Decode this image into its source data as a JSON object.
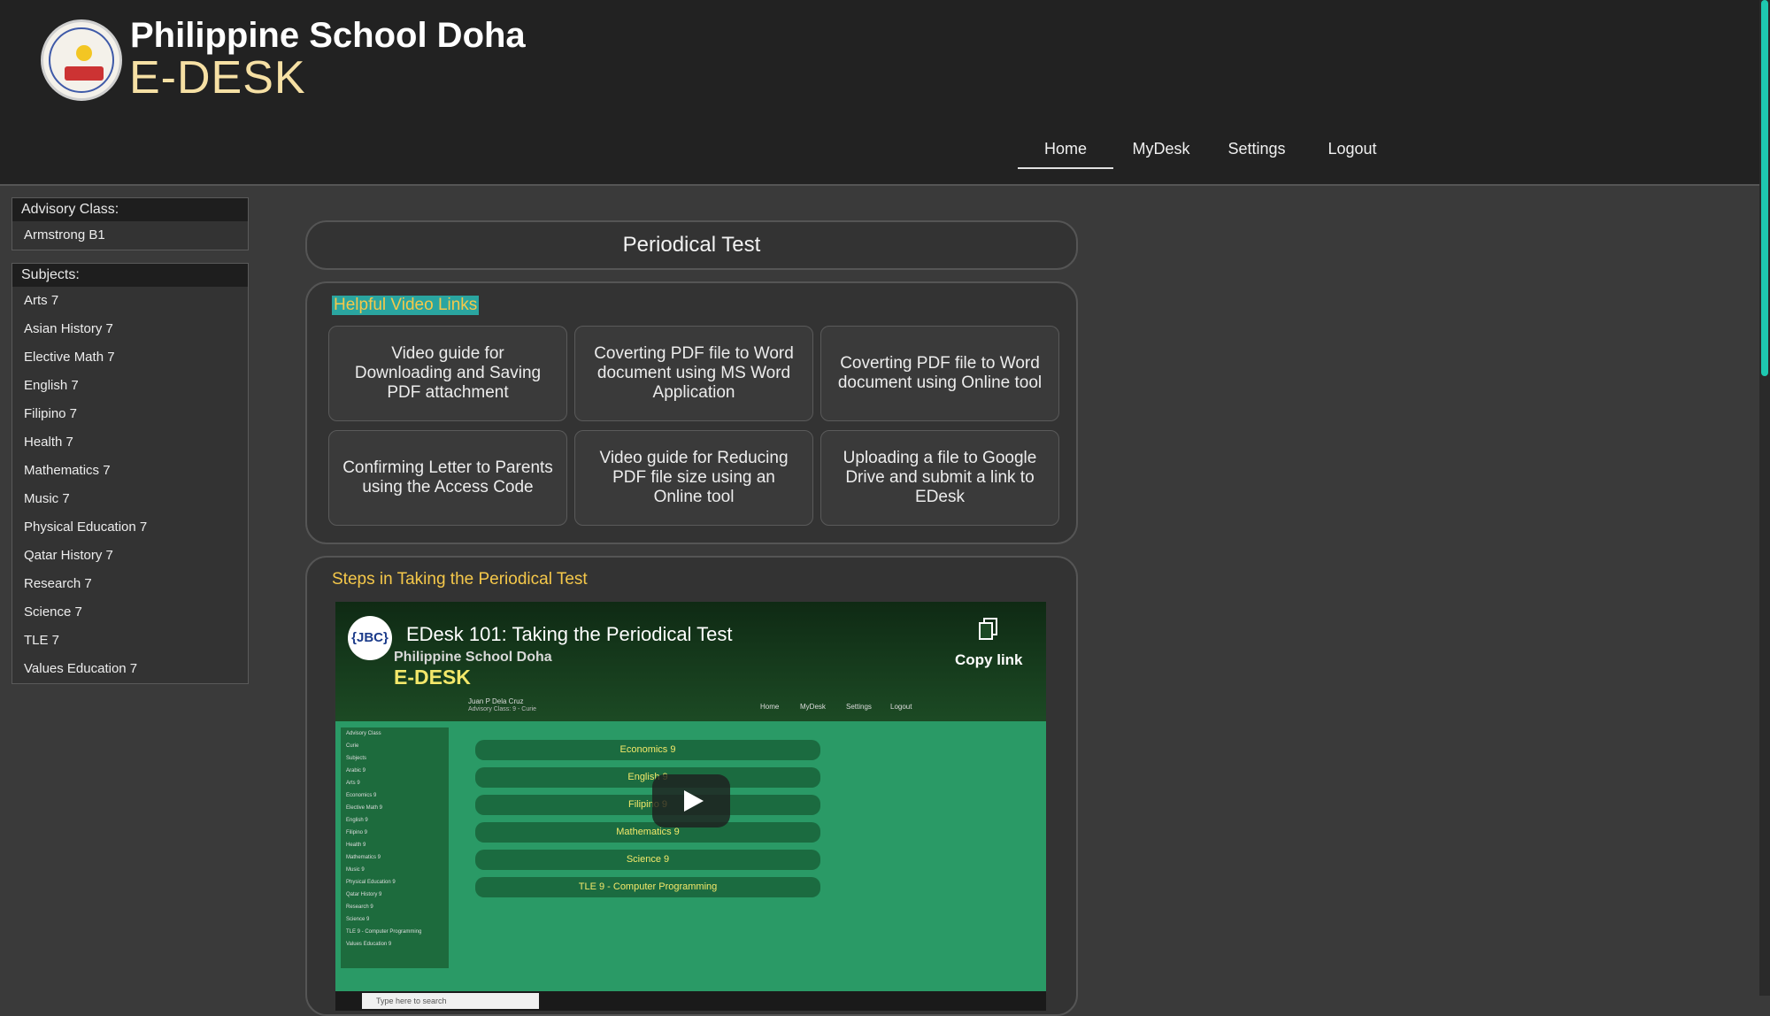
{
  "header": {
    "school_name": "Philippine School Doha",
    "app_name": "E-DESK",
    "nav": [
      {
        "label": "Home",
        "active": true
      },
      {
        "label": "MyDesk",
        "active": false
      },
      {
        "label": "Settings",
        "active": false
      },
      {
        "label": "Logout",
        "active": false
      }
    ]
  },
  "sidebar": {
    "advisory_heading": "Advisory Class:",
    "advisory_class": "Armstrong B1",
    "subjects_heading": "Subjects:",
    "subjects": [
      "Arts 7",
      "Asian History 7",
      "Elective Math 7",
      "English 7",
      "Filipino 7",
      "Health 7",
      "Mathematics 7",
      "Music 7",
      "Physical Education 7",
      "Qatar History 7",
      "Research 7",
      "Science 7",
      "TLE 7",
      "Values Education 7"
    ]
  },
  "main": {
    "page_title": "Periodical Test",
    "links_heading": "Helpful Video Links",
    "video_links": [
      "Video guide for Downloading and Saving PDF attachment",
      "Coverting PDF file to Word document using MS Word Application",
      "Coverting PDF file to Word document using Online tool",
      "Confirming Letter to Parents using the Access Code",
      "Video guide for Reducing PDF file size using an Online tool",
      "Uploading a file to Google Drive and submit a link to EDesk"
    ],
    "steps_heading": "Steps in Taking the Periodical Test"
  },
  "video": {
    "channel_logo": "{JBC}",
    "title": "EDesk 101: Taking the Periodical Test",
    "copy_label": "Copy link",
    "inner_school": "Philippine School Doha",
    "inner_app": "E-DESK",
    "inner_user": "Juan P Dela Cruz",
    "inner_advisory": "Advisory Class: 9 - Curie",
    "inner_nav": [
      "Home",
      "MyDesk",
      "Settings",
      "Logout"
    ],
    "inner_side": [
      "Advisory Class",
      "Curie",
      "Subjects",
      "Arabic 9",
      "Arts 9",
      "Economics 9",
      "Elective Math 9",
      "English 9",
      "Filipino 9",
      "Health 9",
      "Mathematics 9",
      "Music 9",
      "Physical Education 9",
      "Qatar History 9",
      "Research 9",
      "Science 9",
      "TLE 9 - Computer Programming",
      "Values Education 9"
    ],
    "inner_subjects": [
      "Economics 9",
      "English 9",
      "Filipino 9",
      "Mathematics 9",
      "Science 9",
      "TLE 9 - Computer Programming"
    ],
    "taskbar_search": "Type here to search"
  },
  "colors": {
    "accent_heading": "#f5c84a",
    "scroll_thumb": "#1ec8b0",
    "header_bg": "#222222"
  }
}
